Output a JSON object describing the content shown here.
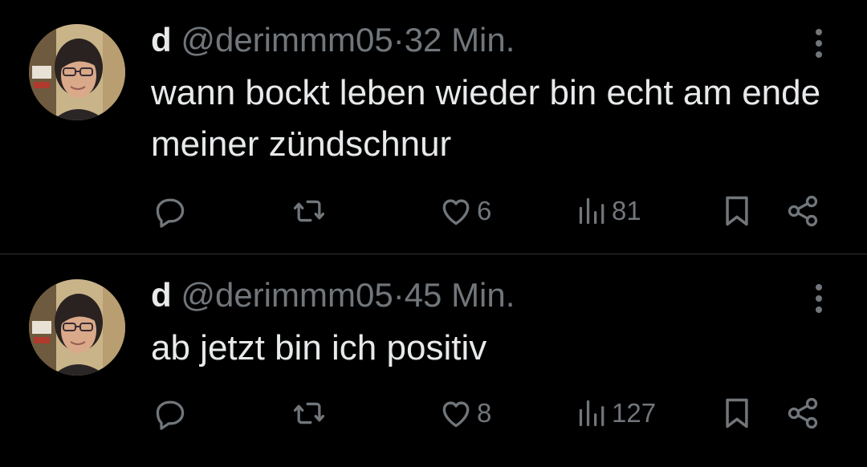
{
  "colors": {
    "background": "#000000",
    "primary_text": "#e7e9ea",
    "secondary_text": "#71767b",
    "divider": "#2f3336"
  },
  "tweets": [
    {
      "display_name": "d",
      "handle": "@derimmm05",
      "separator": "·",
      "time": "32 Min.",
      "text": "wann bockt leben wieder bin echt am ende meiner zündschnur",
      "likes": "6",
      "views": "81",
      "icons": [
        "reply-icon",
        "repost-icon",
        "like-icon",
        "views-icon",
        "bookmark-icon",
        "share-icon",
        "more-icon"
      ]
    },
    {
      "display_name": "d",
      "handle": "@derimmm05",
      "separator": "·",
      "time": "45 Min.",
      "text": "ab jetzt bin ich positiv",
      "likes": "8",
      "views": "127",
      "icons": [
        "reply-icon",
        "repost-icon",
        "like-icon",
        "views-icon",
        "bookmark-icon",
        "share-icon",
        "more-icon"
      ]
    }
  ]
}
